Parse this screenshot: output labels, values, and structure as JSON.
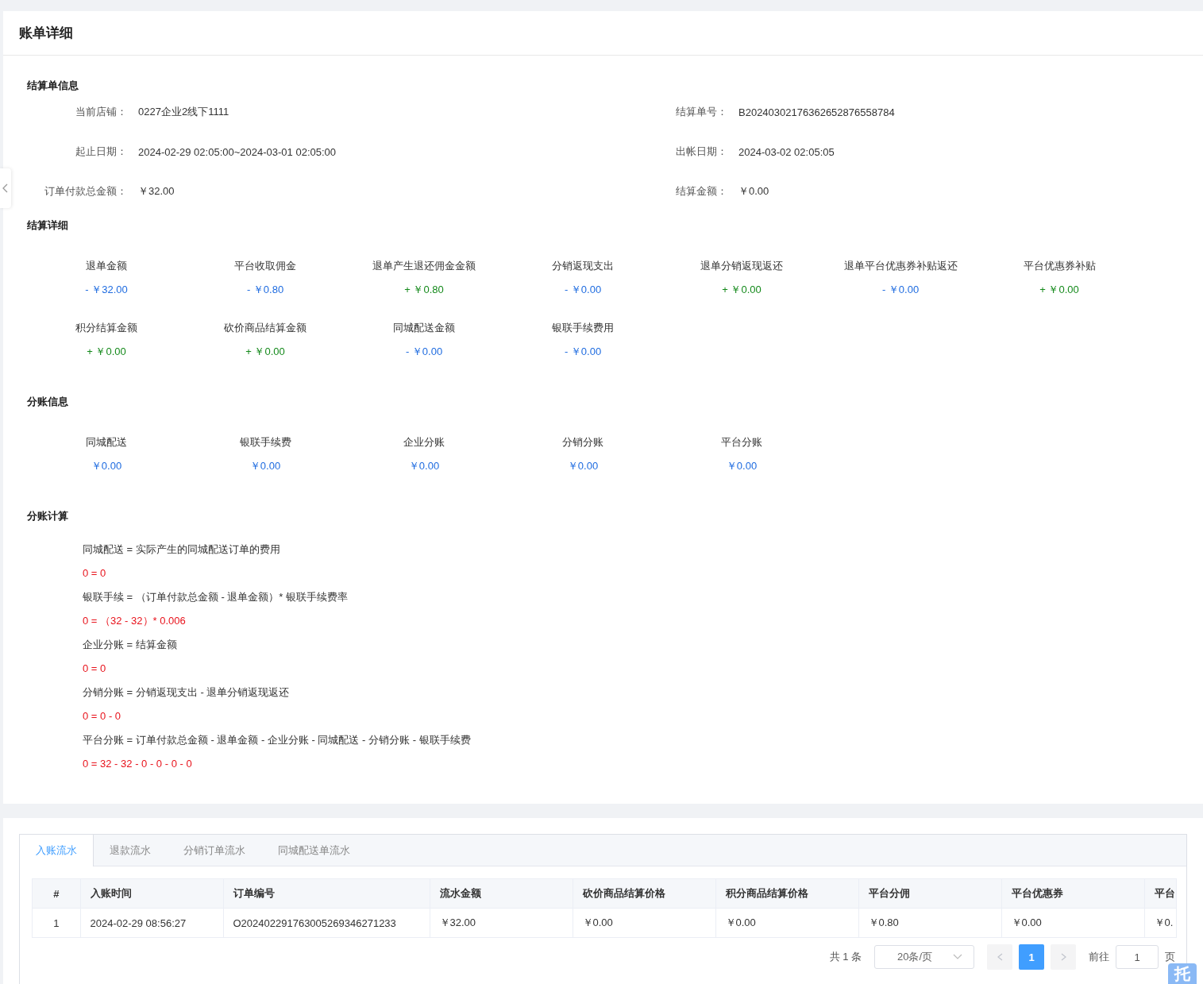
{
  "page_title": "账单详细",
  "settlement_info": {
    "title": "结算单信息",
    "fields": [
      {
        "label": "当前店铺：",
        "value": "0227企业2线下1111"
      },
      {
        "label": "结算单号：",
        "value": "B20240302176362652876558784"
      },
      {
        "label": "起止日期：",
        "value": "2024-02-29 02:05:00~2024-03-01 02:05:00"
      },
      {
        "label": "出帐日期：",
        "value": "2024-03-02 02:05:05"
      },
      {
        "label": "订单付款总金额：",
        "value": "￥32.00"
      },
      {
        "label": "结算金额：",
        "value": "￥0.00"
      }
    ]
  },
  "settlement_detail": {
    "title": "结算详细",
    "items": [
      {
        "label": "退单金额",
        "value": "- ￥32.00",
        "kind": "minus"
      },
      {
        "label": "平台收取佣金",
        "value": "- ￥0.80",
        "kind": "minus"
      },
      {
        "label": "退单产生退还佣金金额",
        "value": "+ ￥0.80",
        "kind": "plus"
      },
      {
        "label": "分销返现支出",
        "value": "- ￥0.00",
        "kind": "minus"
      },
      {
        "label": "退单分销返现返还",
        "value": "+ ￥0.00",
        "kind": "plus"
      },
      {
        "label": "退单平台优惠券补贴返还",
        "value": "- ￥0.00",
        "kind": "minus"
      },
      {
        "label": "平台优惠券补贴",
        "value": "+ ￥0.00",
        "kind": "plus"
      },
      {
        "label": "积分结算金额",
        "value": "+ ￥0.00",
        "kind": "plus"
      },
      {
        "label": "砍价商品结算金额",
        "value": "+ ￥0.00",
        "kind": "plus"
      },
      {
        "label": "同城配送金额",
        "value": "- ￥0.00",
        "kind": "minus"
      },
      {
        "label": "银联手续费用",
        "value": "- ￥0.00",
        "kind": "minus"
      }
    ]
  },
  "split_info": {
    "title": "分账信息",
    "items": [
      {
        "label": "同城配送",
        "value": "￥0.00",
        "kind": "neutral"
      },
      {
        "label": "银联手续费",
        "value": "￥0.00",
        "kind": "neutral"
      },
      {
        "label": "企业分账",
        "value": "￥0.00",
        "kind": "neutral"
      },
      {
        "label": "分销分账",
        "value": "￥0.00",
        "kind": "neutral"
      },
      {
        "label": "平台分账",
        "value": "￥0.00",
        "kind": "neutral"
      }
    ]
  },
  "split_calc": {
    "title": "分账计算",
    "lines": [
      {
        "text": "同城配送 = 实际产生的同城配送订单的费用",
        "kind": "formula"
      },
      {
        "text": "0 = 0",
        "kind": "result"
      },
      {
        "text": "银联手续 = （订单付款总金额 - 退单金额）* 银联手续费率",
        "kind": "formula"
      },
      {
        "text": "0 = （32 - 32）* 0.006",
        "kind": "result"
      },
      {
        "text": "企业分账 = 结算金额",
        "kind": "formula"
      },
      {
        "text": "0 = 0",
        "kind": "result"
      },
      {
        "text": "分销分账 = 分销返现支出 - 退单分销返现返还",
        "kind": "formula"
      },
      {
        "text": "0 = 0 - 0",
        "kind": "result"
      },
      {
        "text": "平台分账 = 订单付款总金额 - 退单金额 - 企业分账 - 同城配送 - 分销分账 - 银联手续费",
        "kind": "formula"
      },
      {
        "text": "0 = 32 - 32 - 0 - 0 - 0 - 0",
        "kind": "result"
      }
    ]
  },
  "tabs": [
    {
      "label": "入账流水",
      "selected": true
    },
    {
      "label": "退款流水",
      "selected": false
    },
    {
      "label": "分销订单流水",
      "selected": false
    },
    {
      "label": "同城配送单流水",
      "selected": false
    }
  ],
  "table": {
    "columns": [
      "#",
      "入账时间",
      "订单编号",
      "流水金额",
      "砍价商品结算价格",
      "积分商品结算价格",
      "平台分佣",
      "平台优惠券",
      "平台"
    ],
    "rows": [
      [
        "1",
        "2024-02-29 08:56:27",
        "O202402291763005269346271233",
        "￥32.00",
        "￥0.00",
        "￥0.00",
        "￥0.80",
        "￥0.00",
        "￥0."
      ]
    ]
  },
  "pagination": {
    "total": "共 1 条",
    "page_size": "20条/页",
    "pages": [
      {
        "label": "1",
        "selected": true
      }
    ],
    "goto_label": "前往",
    "goto_value": "1",
    "goto_suffix": "页"
  },
  "floating_button": "托"
}
